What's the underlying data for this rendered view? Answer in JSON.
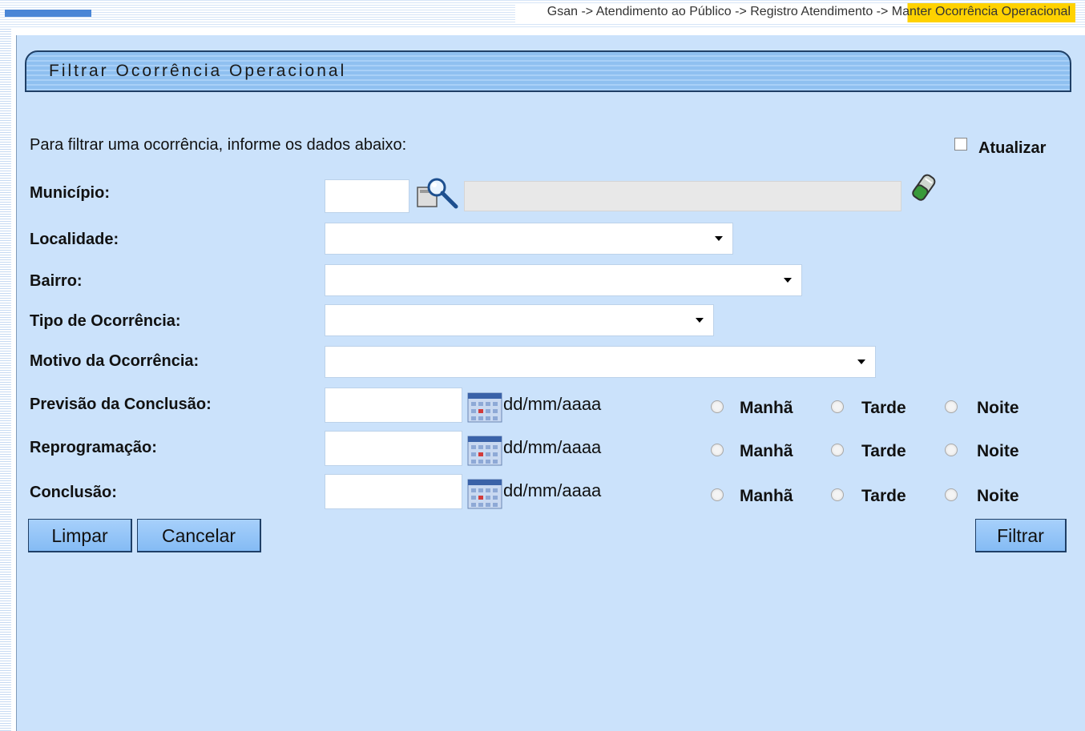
{
  "breadcrumb": "Gsan -> Atendimento ao Público -> Registro Atendimento -> Manter Ocorrência Operacional",
  "title": "Filtrar Ocorrência Operacional",
  "intro": "Para filtrar uma ocorrência, informe os dados abaixo:",
  "atualizar": {
    "label": "Atualizar",
    "checked": false
  },
  "fields": {
    "municipio": "Município:",
    "localidade": "Localidade:",
    "bairro": "Bairro:",
    "tipo": "Tipo de Ocorrência:",
    "motivo": "Motivo da Ocorrência:",
    "previsao": "Previsão da Conclusão:",
    "reprogramacao": "Reprogramação:",
    "conclusao": "Conclusão:"
  },
  "date_format": "dd/mm/aaaa",
  "periods": [
    "Manhã",
    "Tarde",
    "Noite"
  ],
  "buttons": {
    "limpar": "Limpar",
    "cancelar": "Cancelar",
    "filtrar": "Filtrar"
  },
  "colors": {
    "panel": "#cbe2fb",
    "title_bar": "#8fc0f0",
    "highlight": "#ffd200"
  }
}
